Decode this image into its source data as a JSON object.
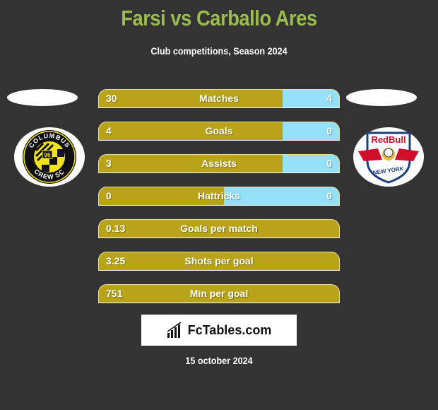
{
  "header": {
    "title": "Farsi vs Carballo Ares",
    "subtitle": "Club competitions, Season 2024"
  },
  "teams": {
    "left": {
      "name": "Columbus Crew SC",
      "logo_text_top": "COLUMBUS",
      "logo_text_bottom": "CREW SC",
      "logo_number": "96"
    },
    "right": {
      "name": "New York Red Bulls",
      "logo_text_top": "RedBull",
      "logo_text_bottom": "NEW YORK"
    }
  },
  "colors": {
    "left_bar": "#b9a419",
    "right_bar": "#94e0f8",
    "title": "#9bbd4a",
    "background": "#333333"
  },
  "stats": [
    {
      "label": "Matches",
      "left": "30",
      "right": "4",
      "right_share": 0.235
    },
    {
      "label": "Goals",
      "left": "4",
      "right": "0",
      "right_share": 0.235
    },
    {
      "label": "Assists",
      "left": "3",
      "right": "0",
      "right_share": 0.235
    },
    {
      "label": "Hattricks",
      "left": "0",
      "right": "0",
      "right_share": 0.48
    },
    {
      "label": "Goals per match",
      "left": "0.13",
      "right": null,
      "right_share": 0
    },
    {
      "label": "Shots per goal",
      "left": "3.25",
      "right": null,
      "right_share": 0
    },
    {
      "label": "Min per goal",
      "left": "751",
      "right": null,
      "right_share": 0
    }
  ],
  "footer": {
    "brand": "FcTables.com",
    "date": "15 october 2024"
  }
}
